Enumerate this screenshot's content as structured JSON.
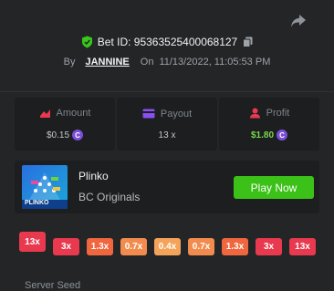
{
  "header": {
    "bet_id": "Bet ID: 95363525400068127",
    "by_label": "By",
    "username": "JANNINE",
    "on_label": "On",
    "date": "11/13/2022, 11:05:53 PM"
  },
  "stats": {
    "amount": {
      "label": "Amount",
      "value": "$0.15"
    },
    "payout": {
      "label": "Payout",
      "value": "13 x"
    },
    "profit": {
      "label": "Profit",
      "value": "$1.80"
    }
  },
  "game": {
    "thumbnail_text": "PLINKO",
    "name": "Plinko",
    "provider": "BC Originals",
    "play_label": "Play Now"
  },
  "multipliers": {
    "selected": "13x",
    "items": [
      "3x",
      "1.3x",
      "0.7x",
      "0.4x",
      "0.7x",
      "1.3x",
      "3x",
      "13x"
    ]
  },
  "footer": {
    "label": "Server Seed"
  },
  "colors": {
    "background": "#232527",
    "card": "#1c1e20",
    "play_button": "#3bc117",
    "profit": "#7bd94a",
    "coin": "#7b4ed8",
    "multiplier_red": "#e8394f",
    "multiplier_orange": "#f0663e",
    "multiplier_amber": "#f4a45a"
  }
}
